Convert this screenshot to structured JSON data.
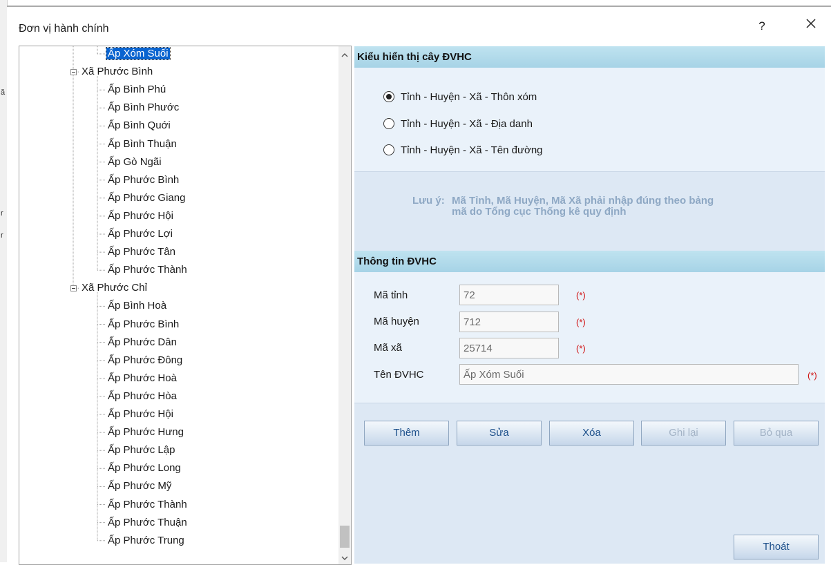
{
  "window": {
    "title": "Đơn vị hành chính",
    "help_glyph": "?",
    "close_glyph": "✕"
  },
  "tree": {
    "nodes": [
      {
        "label": "Ấp Xóm Suối",
        "level": 2,
        "selected": true
      },
      {
        "label": "Xã Phước Bình",
        "level": 1,
        "expander": "collapse"
      },
      {
        "label": "Ấp Bình Phú",
        "level": 2
      },
      {
        "label": "Ấp Bình Phước",
        "level": 2
      },
      {
        "label": "Ấp Bình Quới",
        "level": 2
      },
      {
        "label": "Ấp Bình Thuận",
        "level": 2
      },
      {
        "label": "Ấp Gò Ngãi",
        "level": 2
      },
      {
        "label": "Ấp Phước Bình",
        "level": 2
      },
      {
        "label": "Ấp Phước Giang",
        "level": 2
      },
      {
        "label": "Ấp Phước Hội",
        "level": 2
      },
      {
        "label": "Ấp Phước Lợi",
        "level": 2
      },
      {
        "label": "Ấp Phước Tân",
        "level": 2
      },
      {
        "label": "Ấp Phước Thành",
        "level": 2
      },
      {
        "label": "Xã Phước Chỉ",
        "level": 1,
        "expander": "collapse"
      },
      {
        "label": "Ấp Bình Hoà",
        "level": 2
      },
      {
        "label": "Ấp Phước Bình",
        "level": 2
      },
      {
        "label": "Ấp Phước Dân",
        "level": 2
      },
      {
        "label": "Ấp Phước Đông",
        "level": 2
      },
      {
        "label": "Ấp Phước Hoà",
        "level": 2
      },
      {
        "label": "Ấp Phước Hòa",
        "level": 2
      },
      {
        "label": "Ấp Phước Hội",
        "level": 2
      },
      {
        "label": "Ấp Phước Hưng",
        "level": 2
      },
      {
        "label": "Ấp Phước Lập",
        "level": 2
      },
      {
        "label": "Ấp Phước Long",
        "level": 2
      },
      {
        "label": "Ấp Phước Mỹ",
        "level": 2
      },
      {
        "label": "Ấp Phước Thành",
        "level": 2
      },
      {
        "label": "Ấp Phước Thuận",
        "level": 2
      },
      {
        "label": "Ấp Phước Trung",
        "level": 2
      }
    ],
    "scroll_up": "⌃",
    "scroll_down": "⌄"
  },
  "display_mode": {
    "header": "Kiểu hiển thị cây ĐVHC",
    "options": [
      {
        "label": "Tỉnh - Huyện - Xã - Thôn xóm",
        "checked": true
      },
      {
        "label": "Tỉnh - Huyện - Xã - Địa danh",
        "checked": false
      },
      {
        "label": "Tỉnh - Huyện - Xã - Tên đường",
        "checked": false
      }
    ]
  },
  "note": {
    "label": "Lưu ý:",
    "line1": "Mã Tỉnh, Mã Huyện, Mã Xã phải nhập đúng theo bảng",
    "line2": "mã do Tổng cục Thống kê quy định"
  },
  "info": {
    "header": "Thông tin ĐVHC",
    "fields": [
      {
        "label": "Mã tỉnh",
        "value": "72"
      },
      {
        "label": "Mã huyện",
        "value": "712"
      },
      {
        "label": "Mã xã",
        "value": "25714"
      },
      {
        "label": "Tên ĐVHC",
        "value": "Ấp Xóm Suối"
      }
    ],
    "required_mark": "(*)"
  },
  "buttons": {
    "add": "Thêm",
    "edit": "Sửa",
    "delete": "Xóa",
    "save": "Ghi lại",
    "skip": "Bỏ qua",
    "exit": "Thoát"
  },
  "colors": {
    "selection": "#0a64d0",
    "section_header": "#a6d3e6",
    "panel_bg": "#dde8f4",
    "note_text": "#8ea8c4",
    "required": "#d01010"
  }
}
